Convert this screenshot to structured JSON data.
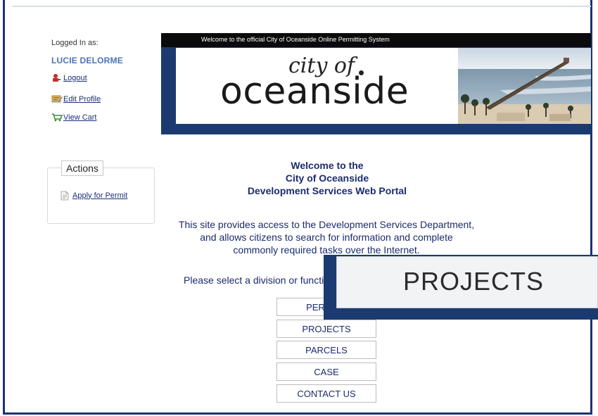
{
  "sidebar": {
    "logged_in_label": "Logged In as:",
    "user_name": "LUCIE DELORME",
    "links": [
      {
        "label": "Logout",
        "icon": "logout-icon"
      },
      {
        "label": "Edit Profile",
        "icon": "edit-profile-icon"
      },
      {
        "label": "View Cart",
        "icon": "cart-icon"
      }
    ],
    "actions": {
      "title": "Actions",
      "apply_label": "Apply for Permit",
      "apply_icon": "document-icon"
    }
  },
  "banner": {
    "welcome_text": "Welcome to the official City of Oceanside Online Permitting System",
    "logo_city_of": "city of",
    "logo_oceanside": "oceanside"
  },
  "main": {
    "welcome_lines": [
      "Welcome to the",
      "City of Oceanside",
      "Development Services Web Portal"
    ],
    "description_lines": [
      "This site provides access to the Development Services Department,",
      "and allows citizens to search for information and complete",
      "commonly required tasks over the Internet."
    ],
    "select_prompt": "Please select a division or function:",
    "nav_buttons": [
      "PERMITS",
      "PROJECTS",
      "PARCELS",
      "CASE",
      "CONTACT US"
    ]
  },
  "zoom_callout": {
    "label": "PROJECTS"
  },
  "colors": {
    "navy": "#1b3a6f",
    "link": "#1c2f7a",
    "user_name": "#4a74b5"
  }
}
